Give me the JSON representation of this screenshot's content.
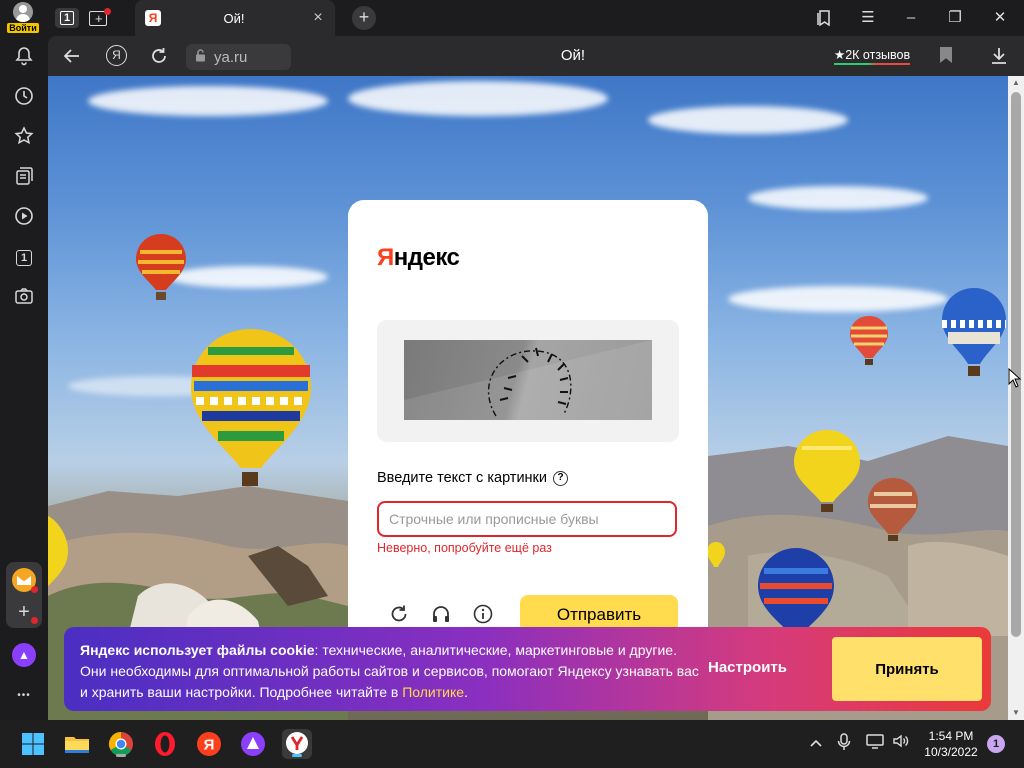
{
  "titlebar": {
    "login_label": "Войти",
    "tab_count": "1",
    "active_tab_title": "Ой!",
    "tab_favicon_letter": "Я",
    "tab_close_glyph": "×",
    "new_tab_glyph": "+"
  },
  "addressbar": {
    "url": "ya.ru",
    "page_title": "Ой!",
    "reviews": "★2К отзывов",
    "ya_button": "Я"
  },
  "sidebar": {
    "shortcut_number": "1",
    "more_glyph": "•••",
    "icons": [
      "bell-icon",
      "history-icon",
      "star-icon",
      "collections-icon",
      "video-icon",
      "tab-number-icon",
      "screenshot-icon",
      "mail-icon",
      "add-icon",
      "alice-icon",
      "more-icon"
    ]
  },
  "captcha": {
    "logo_first": "Я",
    "logo_rest": "ндекс",
    "prompt": "Введите текст с картинки",
    "help_glyph": "?",
    "input_placeholder": "Строчные или прописные буквы",
    "input_value": "",
    "error": "Неверно, попробуйте ещё раз",
    "submit_label": "Отправить",
    "tools": [
      "refresh-icon",
      "audio-icon",
      "info-icon"
    ]
  },
  "cookie": {
    "bold_text": "Яндекс использует файлы cookie",
    "text": ": технические, аналитические, маркетинговые и другие. Они необходимы для оптимальной работы сайтов и сервисов, помогают Яндексу узнавать вас и хранить ваши настройки. Подробнее читайте в ",
    "link_text": "Политике",
    "text_end": ".",
    "configure_label": "Настроить",
    "accept_label": "Принять"
  },
  "taskbar": {
    "apps": [
      "windows-start-icon",
      "file-explorer-icon",
      "chrome-icon",
      "opera-icon",
      "yandex-icon",
      "alice-icon",
      "yandex-browser-icon"
    ],
    "time": "1:54 PM",
    "date": "10/3/2022",
    "notifications": "1"
  },
  "colors": {
    "accent_yellow": "#ffdb4d",
    "error_red": "#e0262d",
    "yandex_red": "#fc3f1d"
  }
}
